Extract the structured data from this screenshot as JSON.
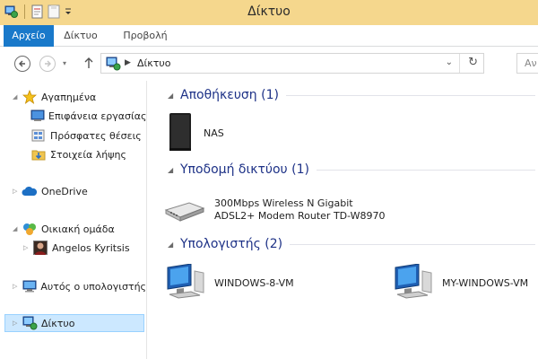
{
  "window": {
    "title": "Δίκτυο"
  },
  "ribbon": {
    "tabs": [
      "Αρχείο",
      "Δίκτυο",
      "Προβολή"
    ]
  },
  "address": {
    "crumb": "Δίκτυο",
    "search_placeholder": "Αν"
  },
  "navpane": {
    "favorites": "Αγαπημένα",
    "fav_items": [
      "Επιφάνεια εργασίας",
      "Πρόσφατες θέσεις",
      "Στοιχεία λήψης"
    ],
    "onedrive": "OneDrive",
    "homegroup": "Οικιακή ομάδα",
    "homegroup_user": "Angelos Kyritsis",
    "thispc": "Αυτός ο υπολογιστής",
    "network": "Δίκτυο"
  },
  "content": {
    "groups": [
      {
        "title": "Αποθήκευση (1)",
        "items": [
          "NAS"
        ]
      },
      {
        "title": "Υποδομή δικτύου (1)",
        "items": [
          [
            "300Mbps Wireless N Gigabit",
            "ADSL2+ Modem Router TD-W8970"
          ]
        ]
      },
      {
        "title": "Υπολογιστής (2)",
        "items": [
          "WINDOWS-8-VM",
          "MY-WINDOWS-VM"
        ]
      }
    ]
  },
  "colors": {
    "titlebar": "#f5d78d",
    "file_tab": "#1979ca",
    "group_title": "#1e3287",
    "selection": "#cce8ff"
  }
}
